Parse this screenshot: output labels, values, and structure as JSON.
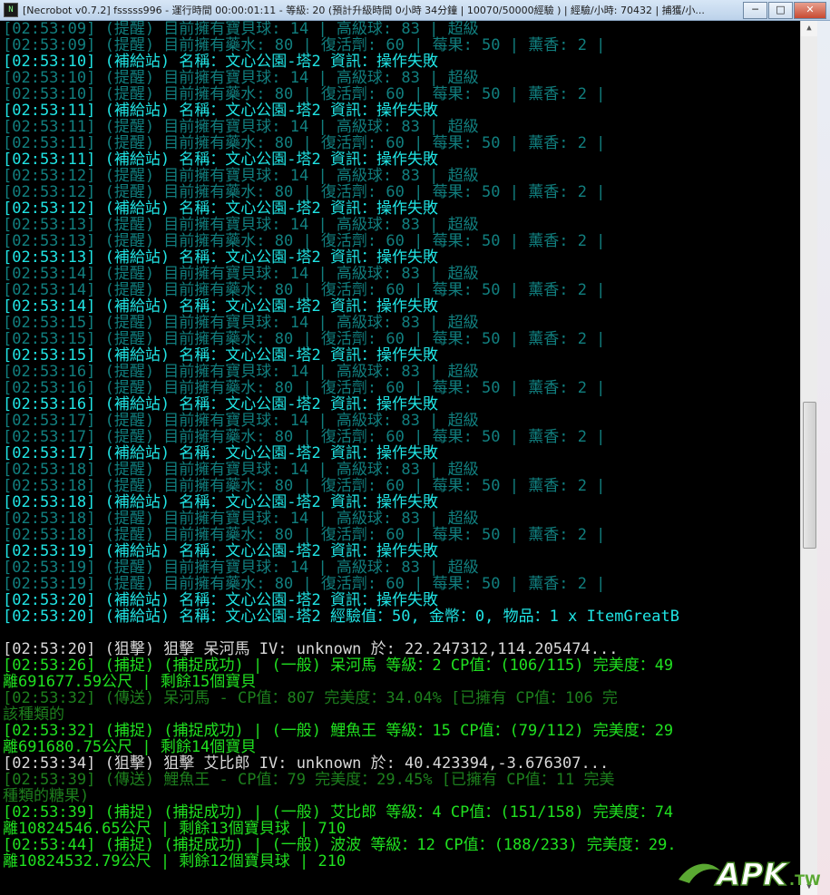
{
  "window": {
    "title": "[Necrobot v0.7.2] fsssss996 - 運行時間 00:00:01:11 - 等級: 20 (預計升級時間 0小時 34分鐘 | 10070/50000經驗 ) | 經驗/小時: 70432 | 捕獲/小...",
    "icon_label": "N",
    "buttons": {
      "minimize": "─",
      "maximize": "□",
      "close": "✕"
    }
  },
  "lines": [
    {
      "text": "[02:53:09] (提醒) 目前擁有寶貝球: 14 | 高級球: 83 | 超級",
      "color": "dim"
    },
    {
      "text": "[02:53:09] (提醒) 目前擁有藥水: 80 | 復活劑: 60 | 莓果: 50 | 薰香: 2 |",
      "color": "dim"
    },
    {
      "text": "[02:53:10] (補給站) 名稱：文心公園-塔2 資訊：操作失敗",
      "color": "cyan"
    },
    {
      "text": "[02:53:10] (提醒) 目前擁有寶貝球: 14 | 高級球: 83 | 超級",
      "color": "dim"
    },
    {
      "text": "[02:53:10] (提醒) 目前擁有藥水: 80 | 復活劑: 60 | 莓果: 50 | 薰香: 2 |",
      "color": "dim"
    },
    {
      "text": "[02:53:11] (補給站) 名稱：文心公園-塔2 資訊：操作失敗",
      "color": "cyan"
    },
    {
      "text": "[02:53:11] (提醒) 目前擁有寶貝球: 14 | 高級球: 83 | 超級",
      "color": "dim"
    },
    {
      "text": "[02:53:11] (提醒) 目前擁有藥水: 80 | 復活劑: 60 | 莓果: 50 | 薰香: 2 |",
      "color": "dim"
    },
    {
      "text": "[02:53:11] (補給站) 名稱：文心公園-塔2 資訊：操作失敗",
      "color": "cyan"
    },
    {
      "text": "[02:53:12] (提醒) 目前擁有寶貝球: 14 | 高級球: 83 | 超級",
      "color": "dim"
    },
    {
      "text": "[02:53:12] (提醒) 目前擁有藥水: 80 | 復活劑: 60 | 莓果: 50 | 薰香: 2 |",
      "color": "dim"
    },
    {
      "text": "[02:53:12] (補給站) 名稱：文心公園-塔2 資訊：操作失敗",
      "color": "cyan"
    },
    {
      "text": "[02:53:13] (提醒) 目前擁有寶貝球: 14 | 高級球: 83 | 超級",
      "color": "dim"
    },
    {
      "text": "[02:53:13] (提醒) 目前擁有藥水: 80 | 復活劑: 60 | 莓果: 50 | 薰香: 2 |",
      "color": "dim"
    },
    {
      "text": "[02:53:13] (補給站) 名稱：文心公園-塔2 資訊：操作失敗",
      "color": "cyan"
    },
    {
      "text": "[02:53:14] (提醒) 目前擁有寶貝球: 14 | 高級球: 83 | 超級",
      "color": "dim"
    },
    {
      "text": "[02:53:14] (提醒) 目前擁有藥水: 80 | 復活劑: 60 | 莓果: 50 | 薰香: 2 |",
      "color": "dim"
    },
    {
      "text": "[02:53:14] (補給站) 名稱：文心公園-塔2 資訊：操作失敗",
      "color": "cyan"
    },
    {
      "text": "[02:53:15] (提醒) 目前擁有寶貝球: 14 | 高級球: 83 | 超級",
      "color": "dim"
    },
    {
      "text": "[02:53:15] (提醒) 目前擁有藥水: 80 | 復活劑: 60 | 莓果: 50 | 薰香: 2 |",
      "color": "dim"
    },
    {
      "text": "[02:53:15] (補給站) 名稱：文心公園-塔2 資訊：操作失敗",
      "color": "cyan"
    },
    {
      "text": "[02:53:16] (提醒) 目前擁有寶貝球: 14 | 高級球: 83 | 超級",
      "color": "dim"
    },
    {
      "text": "[02:53:16] (提醒) 目前擁有藥水: 80 | 復活劑: 60 | 莓果: 50 | 薰香: 2 |",
      "color": "dim"
    },
    {
      "text": "[02:53:16] (補給站) 名稱：文心公園-塔2 資訊：操作失敗",
      "color": "cyan"
    },
    {
      "text": "[02:53:17] (提醒) 目前擁有寶貝球: 14 | 高級球: 83 | 超級",
      "color": "dim"
    },
    {
      "text": "[02:53:17] (提醒) 目前擁有藥水: 80 | 復活劑: 60 | 莓果: 50 | 薰香: 2 |",
      "color": "dim"
    },
    {
      "text": "[02:53:17] (補給站) 名稱：文心公園-塔2 資訊：操作失敗",
      "color": "cyan"
    },
    {
      "text": "[02:53:18] (提醒) 目前擁有寶貝球: 14 | 高級球: 83 | 超級",
      "color": "dim"
    },
    {
      "text": "[02:53:18] (提醒) 目前擁有藥水: 80 | 復活劑: 60 | 莓果: 50 | 薰香: 2 |",
      "color": "dim"
    },
    {
      "text": "[02:53:18] (補給站) 名稱：文心公園-塔2 資訊：操作失敗",
      "color": "cyan"
    },
    {
      "text": "[02:53:18] (提醒) 目前擁有寶貝球: 14 | 高級球: 83 | 超級",
      "color": "dim"
    },
    {
      "text": "[02:53:18] (提醒) 目前擁有藥水: 80 | 復活劑: 60 | 莓果: 50 | 薰香: 2 |",
      "color": "dim"
    },
    {
      "text": "[02:53:19] (補給站) 名稱：文心公園-塔2 資訊：操作失敗",
      "color": "cyan"
    },
    {
      "text": "[02:53:19] (提醒) 目前擁有寶貝球: 14 | 高級球: 83 | 超級",
      "color": "dim"
    },
    {
      "text": "[02:53:19] (提醒) 目前擁有藥水: 80 | 復活劑: 60 | 莓果: 50 | 薰香: 2 |",
      "color": "dim"
    },
    {
      "text": "[02:53:20] (補給站) 名稱：文心公園-塔2 資訊：操作失敗",
      "color": "cyan"
    },
    {
      "text": "[02:53:20] (補給站) 名稱：文心公園-塔2 經驗值：50, 金幣：0, 物品：1 x ItemGreatB",
      "color": "cyan"
    },
    {
      "text": "",
      "color": "blank"
    },
    {
      "text": "[02:53:20] (狙擊) 狙擊 呆河馬 IV: unknown  於: 22.247312,114.205474...",
      "color": "white"
    },
    {
      "text": "[02:53:26] (捕捉) (捕捉成功) | (一般) 呆河馬 等級：2  CP值：(106/115) 完美度：49",
      "color": "green"
    },
    {
      "text": "離691677.59公尺 | 剩餘15個寶貝",
      "color": "green"
    },
    {
      "text": "[02:53:32] (傳送) 呆河馬     - CP值：807  完美度：34.04%  [已擁有 CP值：106  完",
      "color": "dgreen"
    },
    {
      "text": "該種類的",
      "color": "dgreen"
    },
    {
      "text": "[02:53:32] (捕捉) (捕捉成功) | (一般) 鯉魚王 等級：15  CP值：(79/112) 完美度：29",
      "color": "green"
    },
    {
      "text": "離691680.75公尺 | 剩餘14個寶貝",
      "color": "green"
    },
    {
      "text": "[02:53:34] (狙擊) 狙擊 艾比郎 IV: unknown  於: 40.423394,-3.676307...",
      "color": "white"
    },
    {
      "text": "[02:53:39] (傳送) 鯉魚王     - CP值：79  完美度：29.45%  [已擁有 CP值：11  完美",
      "color": "dgreen"
    },
    {
      "text": "種類的糖果)",
      "color": "dgreen"
    },
    {
      "text": "[02:53:39] (捕捉) (捕捉成功) | (一般) 艾比郎 等級：4  CP值：(151/158) 完美度：74",
      "color": "green"
    },
    {
      "text": "離10824546.65公尺 | 剩餘13個寶貝球 | 710",
      "color": "green"
    },
    {
      "text": "[02:53:44] (捕捉) (捕捉成功) | (一般) 波波 等級：12  CP值：(188/233) 完美度：29.",
      "color": "green"
    },
    {
      "text": "離10824532.79公尺 | 剩餘12個寶貝球 | 210",
      "color": "green"
    }
  ],
  "watermark": {
    "text": "APK",
    "suffix": ".TW"
  },
  "colors": {
    "dim": "#117f7f",
    "cyan": "#20e4e4",
    "white": "#d8d8d8",
    "green": "#20e020",
    "dgreen": "#1d7f1d"
  }
}
